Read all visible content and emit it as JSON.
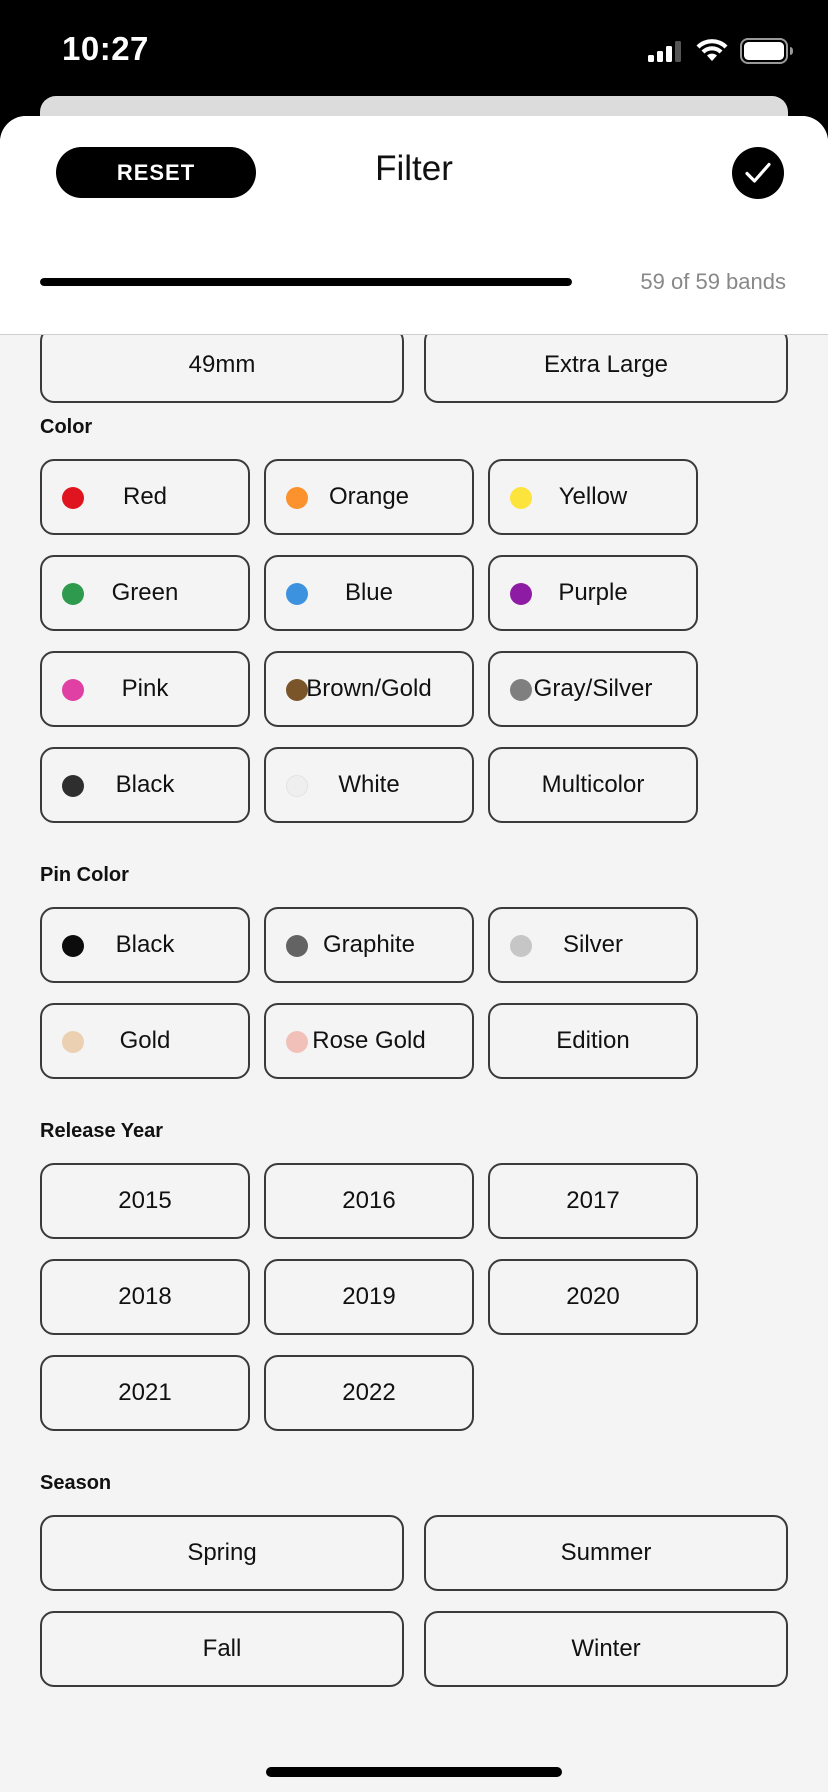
{
  "status": {
    "time": "10:27"
  },
  "header": {
    "reset_label": "RESET",
    "title": "Filter",
    "count_text": "59 of 59 bands",
    "progress_fraction": 1.0
  },
  "partial_row": [
    "49mm",
    "Extra Large"
  ],
  "sections": {
    "color": {
      "label": "Color",
      "items": [
        {
          "label": "Red",
          "color": "#e0141e"
        },
        {
          "label": "Orange",
          "color": "#fb922d"
        },
        {
          "label": "Yellow",
          "color": "#fde43c"
        },
        {
          "label": "Green",
          "color": "#2e9a4d"
        },
        {
          "label": "Blue",
          "color": "#3d92e0"
        },
        {
          "label": "Purple",
          "color": "#8e1ba4"
        },
        {
          "label": "Pink",
          "color": "#e03fa3"
        },
        {
          "label": "Brown/Gold",
          "color": "#7a552a"
        },
        {
          "label": "Gray/Silver",
          "color": "#7f7f7f"
        },
        {
          "label": "Black",
          "color": "#2e2e2e"
        },
        {
          "label": "White",
          "color": "#efefef"
        },
        {
          "label": "Multicolor",
          "color": null
        }
      ]
    },
    "pin_color": {
      "label": "Pin Color",
      "items": [
        {
          "label": "Black",
          "color": "#0c0c0c"
        },
        {
          "label": "Graphite",
          "color": "#636363"
        },
        {
          "label": "Silver",
          "color": "#c6c6c6"
        },
        {
          "label": "Gold",
          "color": "#ecd0b2"
        },
        {
          "label": "Rose Gold",
          "color": "#f1c1b9"
        },
        {
          "label": "Edition",
          "color": null
        }
      ]
    },
    "release_year": {
      "label": "Release Year",
      "items": [
        "2015",
        "2016",
        "2017",
        "2018",
        "2019",
        "2020",
        "2021",
        "2022"
      ]
    },
    "season": {
      "label": "Season",
      "items": [
        "Spring",
        "Summer",
        "Fall",
        "Winter"
      ]
    }
  }
}
